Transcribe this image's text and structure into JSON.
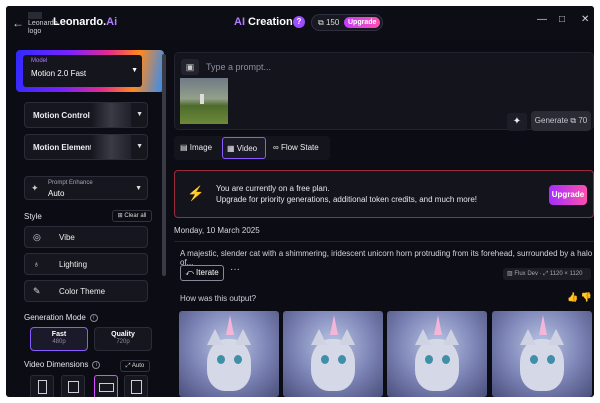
{
  "header": {
    "back_icon": "←",
    "logo_alt": "Leonardo logo",
    "brand_main": "Leonardo.",
    "brand_accent": "Ai",
    "title_accent": "AI",
    "title_main": " Creation",
    "help_label": "?",
    "credits": "150",
    "upgrade_label": "Upgrade",
    "window_controls": [
      "—",
      "□",
      "✕"
    ]
  },
  "sidebar": {
    "model": {
      "label": "Model",
      "value": "Motion 2.0 Fast"
    },
    "motion_control": "Motion Control",
    "motion_elements": "Motion Elements",
    "prompt_enhance": {
      "label": "Prompt Enhance",
      "value": "Auto"
    },
    "style_heading": "Style",
    "clear_all": "Clear all",
    "styles": [
      "Vibe",
      "Lighting",
      "Color Theme"
    ],
    "generation_mode_heading": "Generation Mode",
    "modes": [
      {
        "label": "Fast",
        "sub": "480p",
        "active": true
      },
      {
        "label": "Quality",
        "sub": "720p",
        "active": false
      }
    ],
    "video_dimensions_heading": "Video Dimensions",
    "auto_label": "Auto"
  },
  "main": {
    "prompt_placeholder": "Type a prompt...",
    "generate_label": "Generate",
    "generate_cost": "70",
    "tabs": [
      "Image",
      "Video",
      "Flow State"
    ],
    "active_tab": "Video",
    "banner": {
      "line1": "You are currently on a free plan.",
      "line2": "Upgrade for priority generations, additional token credits, and much more!",
      "button": "Upgrade"
    },
    "date": "Monday, 10 March 2025",
    "description": "A majestic, slender cat with a shimmering, iridescent unicorn horn protruding from its forehead, surrounded by a halo of...",
    "iterate_label": "Iterate",
    "more_label": "···",
    "model_tag": "Flux Dev",
    "resolution": "1120 × 1120",
    "feedback_question": "How was this output?"
  },
  "colors": {
    "accent": "#b07cff",
    "upgrade_gradient_start": "#c43dff",
    "upgrade_gradient_end": "#ff4fae",
    "background": "#0c0d14"
  }
}
